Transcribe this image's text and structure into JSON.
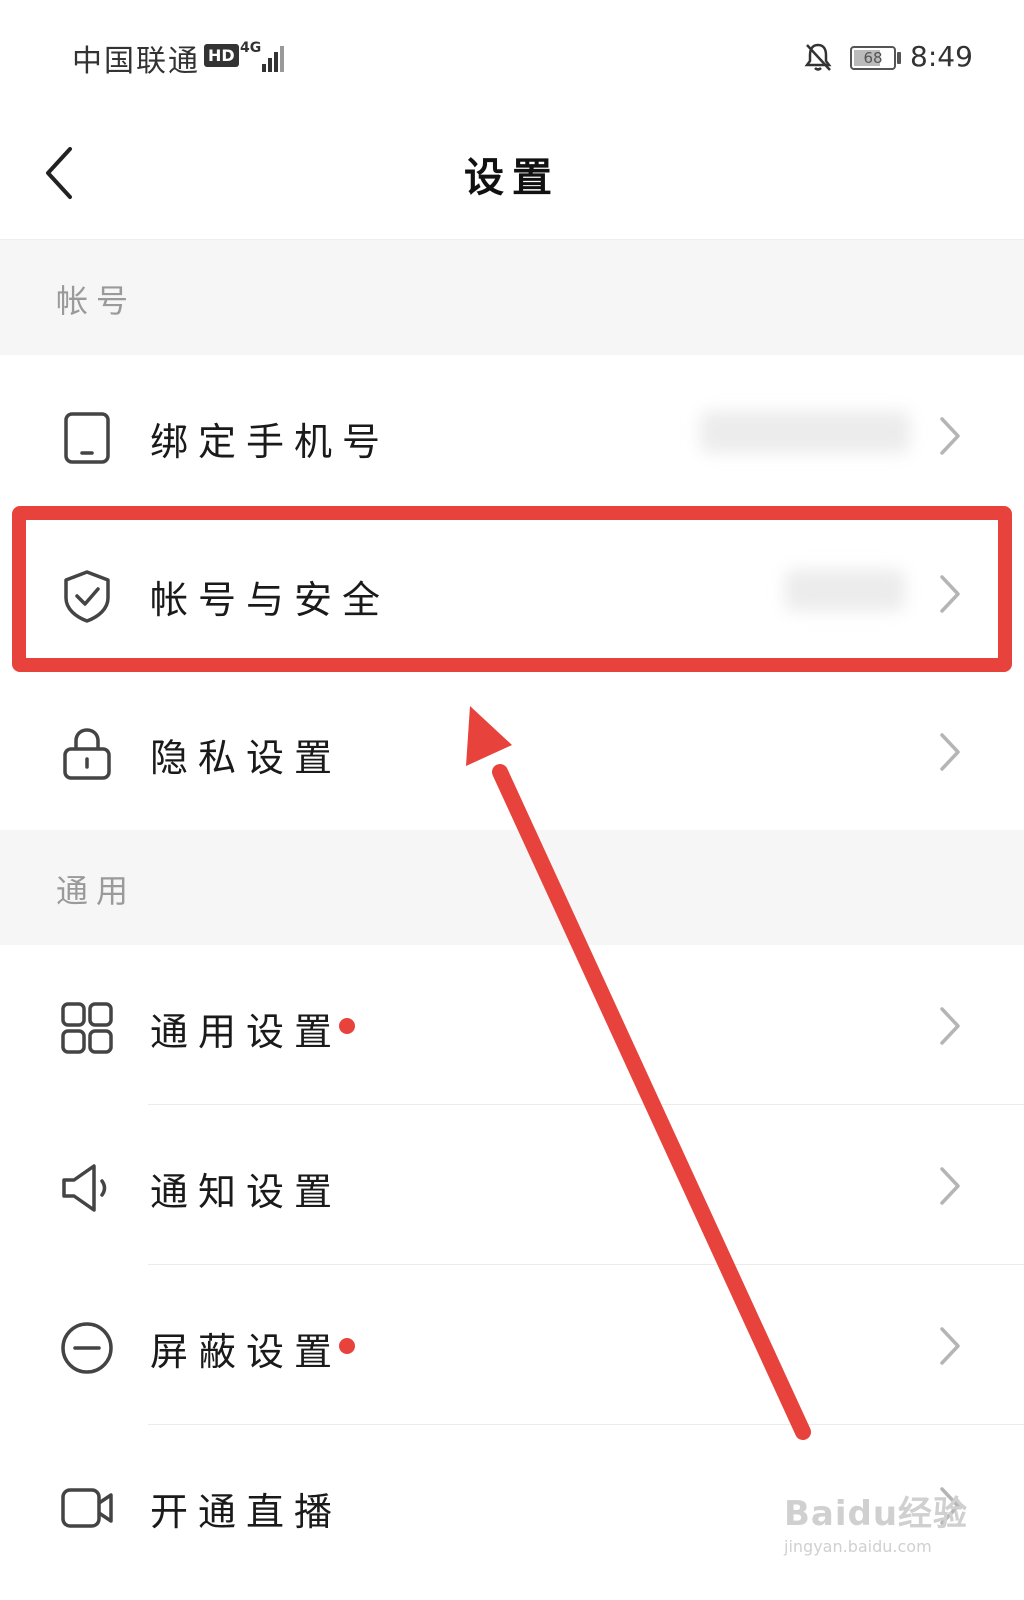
{
  "status_bar": {
    "carrier": "中国联通",
    "hd": "HD",
    "network": "4G",
    "battery": "68",
    "time": "8:49"
  },
  "header": {
    "title": "设置"
  },
  "sections": [
    {
      "title": "帐号",
      "items": [
        {
          "label": "绑定手机号",
          "icon": "phone-icon",
          "value_blurred": true
        },
        {
          "label": "帐号与安全",
          "icon": "shield-check-icon",
          "value_blurred": true,
          "highlighted": true
        },
        {
          "label": "隐私设置",
          "icon": "lock-icon"
        }
      ]
    },
    {
      "title": "通用",
      "items": [
        {
          "label": "通用设置",
          "icon": "grid-icon",
          "badge": "red-dot"
        },
        {
          "label": "通知设置",
          "icon": "speaker-icon"
        },
        {
          "label": "屏蔽设置",
          "icon": "minus-circle-icon",
          "badge": "red-dot"
        },
        {
          "label": "开通直播",
          "icon": "video-camera-icon"
        }
      ]
    }
  ],
  "annotation": {
    "highlight_color": "#e8423c",
    "arrow_color": "#e8423c"
  },
  "watermark": {
    "main": "Baidu经验",
    "sub": "jingyan.baidu.com"
  }
}
